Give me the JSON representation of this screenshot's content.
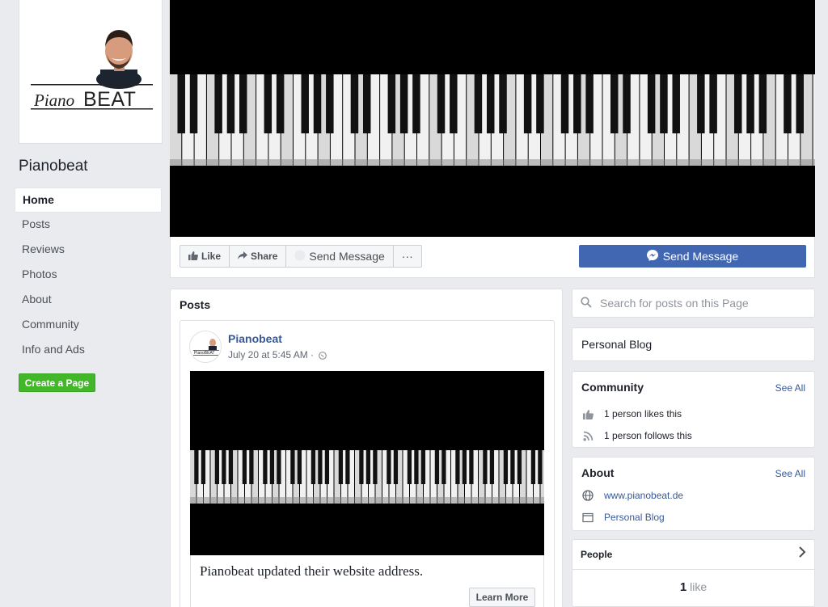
{
  "page": {
    "name": "Pianobeat",
    "logo_text": "PianoBEAT"
  },
  "nav": {
    "items": [
      {
        "label": "Home",
        "active": true
      },
      {
        "label": "Posts"
      },
      {
        "label": "Reviews"
      },
      {
        "label": "Photos"
      },
      {
        "label": "About"
      },
      {
        "label": "Community"
      },
      {
        "label": "Info and Ads"
      }
    ],
    "create_page": "Create a Page"
  },
  "actions": {
    "like": "Like",
    "share": "Share",
    "send_message": "Send Message",
    "more": "···",
    "primary_send_message": "Send Message"
  },
  "posts": {
    "title": "Posts",
    "author": "Pianobeat",
    "meta": "July 20 at 5:45 AM ·",
    "link_text": "Pianobeat updated their website address.",
    "learn_more": "Learn More"
  },
  "sidebar": {
    "search_placeholder": "Search for posts on this Page",
    "category": "Personal Blog",
    "community": {
      "title": "Community",
      "see_all": "See All",
      "likes": "1 person likes this",
      "follows": "1 person follows this"
    },
    "about": {
      "title": "About",
      "see_all": "See All",
      "website": "www.pianobeat.de",
      "category": "Personal Blog"
    },
    "people": {
      "title": "People",
      "like_count": "1",
      "like_label": "like"
    }
  },
  "colors": {
    "accent": "#4267b2",
    "link": "#365899",
    "create_green": "#42b72a",
    "background": "#e9ebee"
  }
}
